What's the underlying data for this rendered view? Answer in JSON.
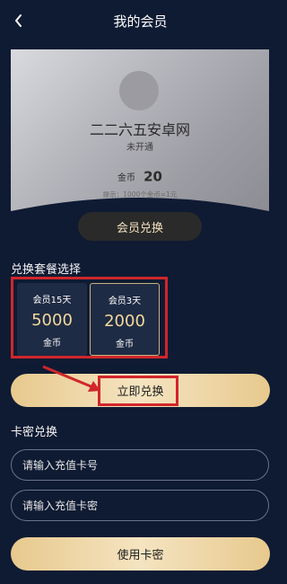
{
  "header": {
    "back_icon": "chevron-left-icon",
    "title": "我的会员"
  },
  "card": {
    "username": "二二六五安卓网",
    "status": "未开通",
    "coins_label": "金币",
    "coins_value": "20",
    "hint": "提示：1000个金币=1元"
  },
  "redeem_pill": {
    "label": "会员兑换"
  },
  "plans_section": {
    "title": "兑换套餐选择",
    "plans": [
      {
        "title": "会员15天",
        "amount": "5000",
        "unit": "金币"
      },
      {
        "title": "会员3天",
        "amount": "2000",
        "unit": "金币"
      }
    ]
  },
  "primary_button": {
    "label": "立即兑换"
  },
  "card_section": {
    "title": "卡密兑换",
    "card_number_placeholder": "请输入充值卡号",
    "card_password_placeholder": "请输入充值卡密",
    "use_button": "使用卡密"
  },
  "colors": {
    "background": "#0f1b33",
    "gold": "#e7c98d",
    "highlight": "#d1262b"
  }
}
